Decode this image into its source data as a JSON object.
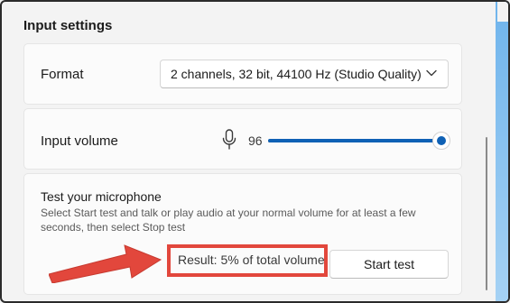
{
  "section": {
    "title": "Input settings"
  },
  "format": {
    "label": "Format",
    "selected_value": "2 channels, 32 bit, 44100 Hz (Studio Quality)"
  },
  "input_volume": {
    "label": "Input volume",
    "value": "96",
    "slider_fraction": 0.96
  },
  "test": {
    "title": "Test your microphone",
    "description": "Select Start test and talk or play audio at your normal volume for at least a few seconds, then select Stop test",
    "result": "Result: 5% of total volume",
    "start_label": "Start test"
  },
  "icons": {
    "chevron": "chevron-down-icon",
    "mic": "microphone-icon",
    "arrow": "annotation-arrow"
  },
  "colors": {
    "accent": "#0f61b5",
    "highlight": "#e2473c",
    "background": "#f3f3f3",
    "card": "#fbfbfb"
  }
}
